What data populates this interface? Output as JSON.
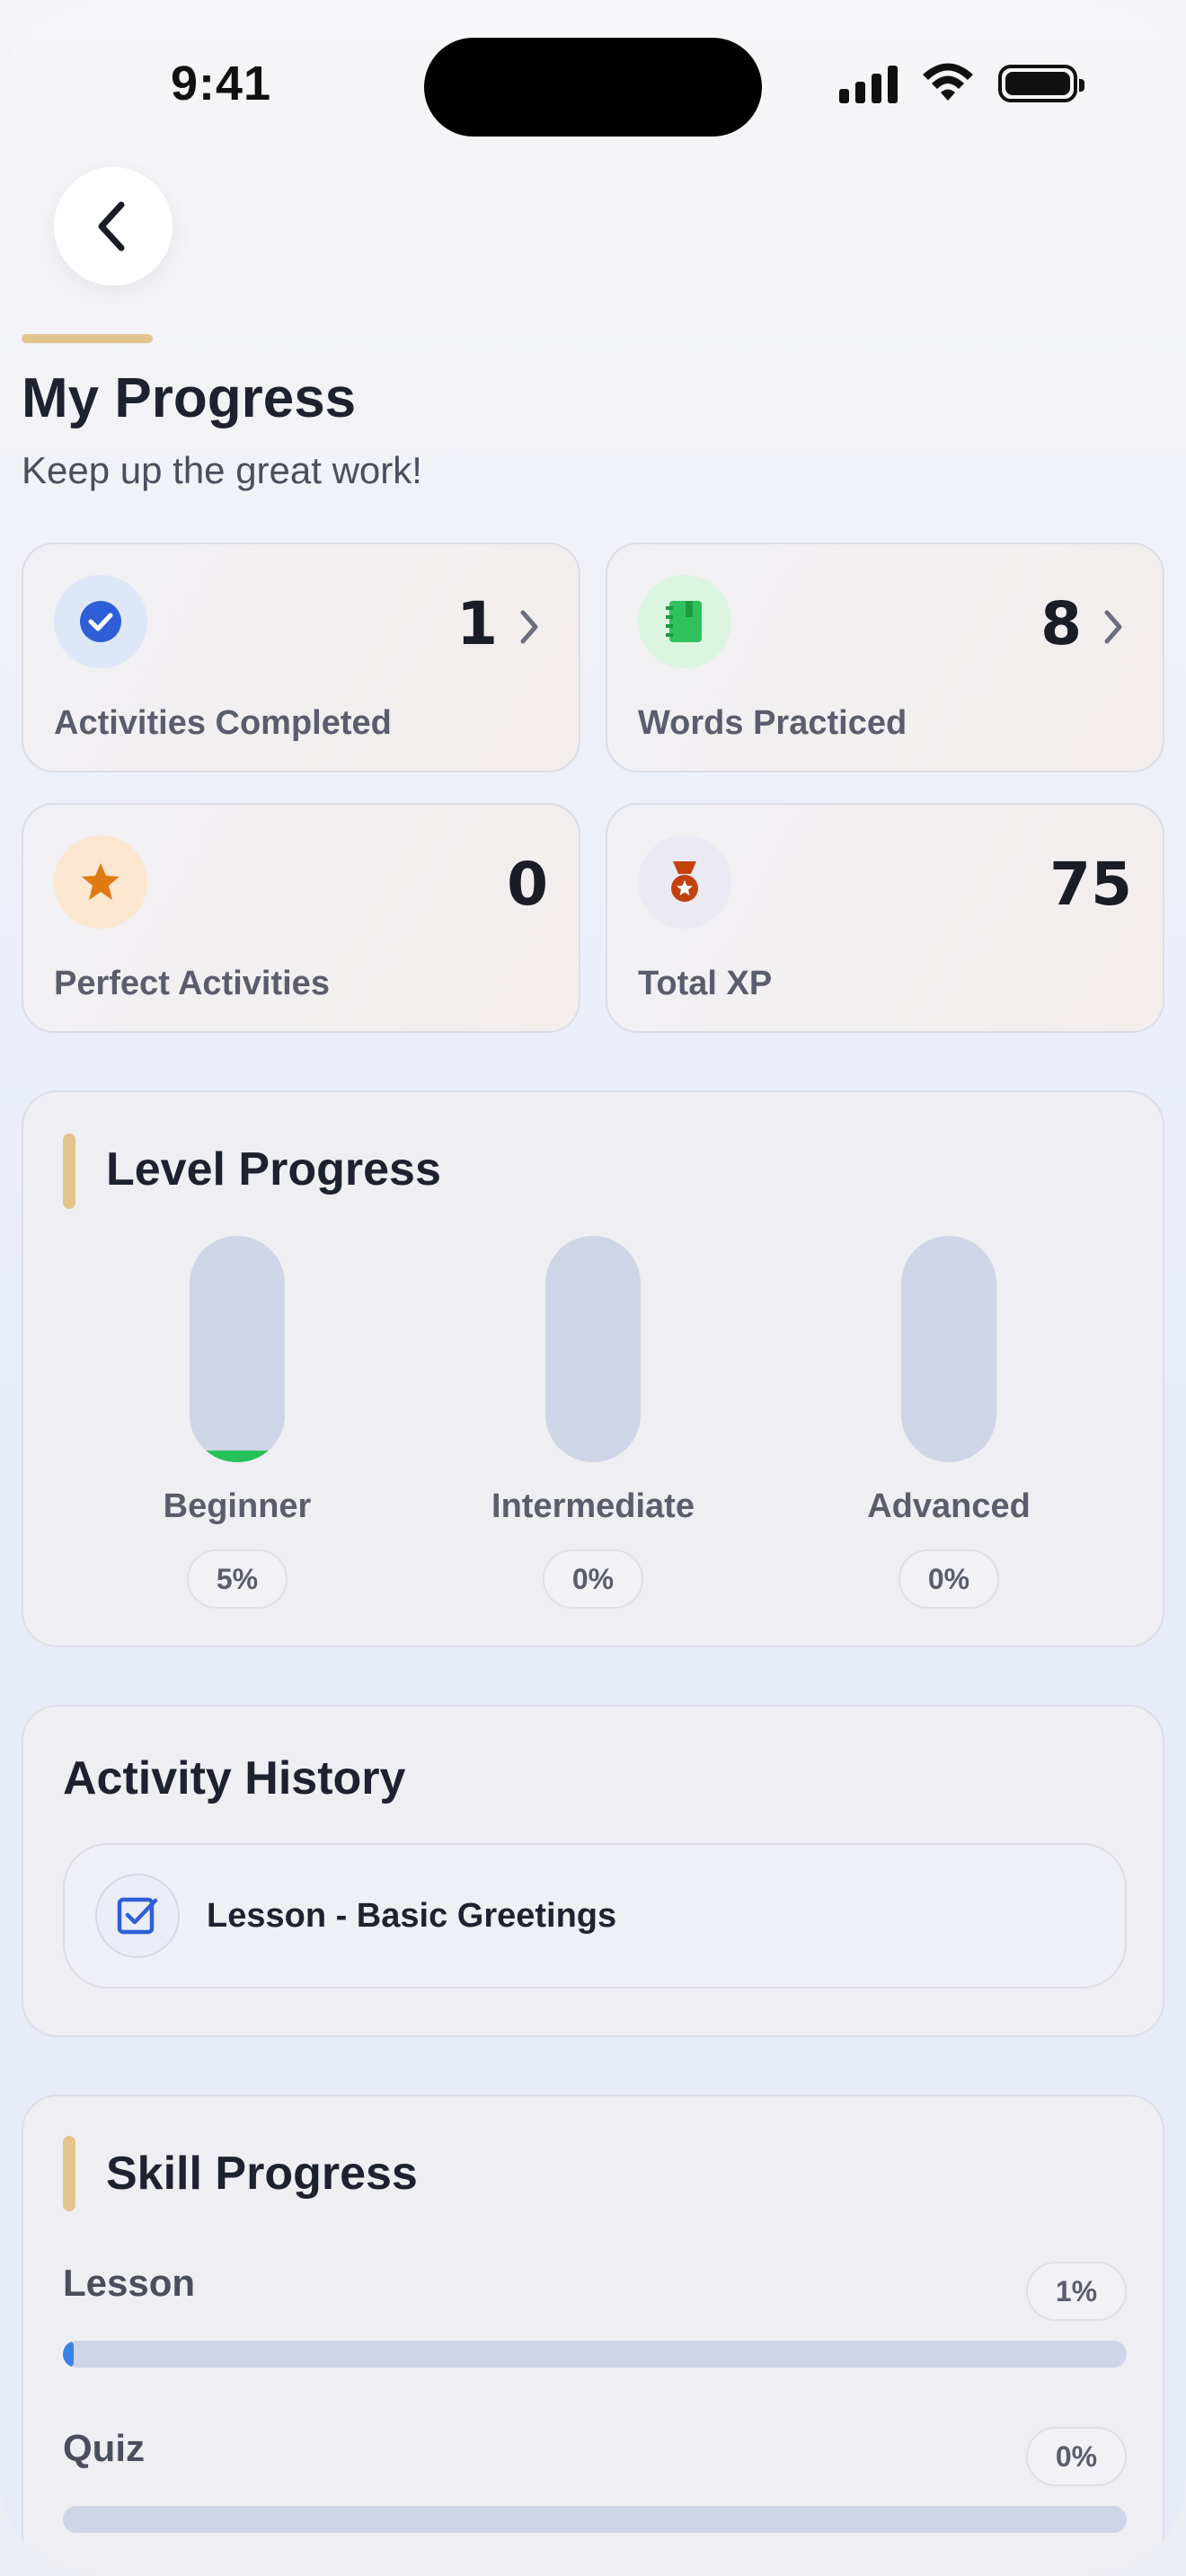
{
  "status_bar": {
    "time": "9:41"
  },
  "header": {
    "title": "My Progress",
    "subtitle": "Keep up the great work!"
  },
  "stats": [
    {
      "label": "Activities Completed",
      "value": "1",
      "icon": "check-circle-icon",
      "color": "#2f5fd8",
      "has_chevron": true
    },
    {
      "label": "Words Practiced",
      "value": "8",
      "icon": "notebook-icon",
      "color": "#2ec15c",
      "has_chevron": true
    },
    {
      "label": "Perfect Activities",
      "value": "0",
      "icon": "star-icon",
      "color": "#e07a12",
      "has_chevron": false
    },
    {
      "label": "Total XP",
      "value": "75",
      "icon": "medal-icon",
      "color": "#c2410c",
      "has_chevron": false
    }
  ],
  "level_progress": {
    "title": "Level Progress",
    "levels": [
      {
        "name": "Beginner",
        "percent_label": "5%",
        "fraction": 0.05
      },
      {
        "name": "Intermediate",
        "percent_label": "0%",
        "fraction": 0
      },
      {
        "name": "Advanced",
        "percent_label": "0%",
        "fraction": 0
      }
    ]
  },
  "activity_history": {
    "title": "Activity History",
    "items": [
      {
        "label": "Lesson - Basic Greetings",
        "icon": "checkbox-icon"
      }
    ]
  },
  "skill_progress": {
    "title": "Skill Progress",
    "skills": [
      {
        "name": "Lesson",
        "percent_label": "1%",
        "fraction": 0.01
      },
      {
        "name": "Quiz",
        "percent_label": "0%",
        "fraction": 0
      }
    ]
  },
  "colors": {
    "accent_gold": "#e2c58e",
    "level_fill": "#27c15a",
    "skill_fill": "#3a82e6"
  }
}
